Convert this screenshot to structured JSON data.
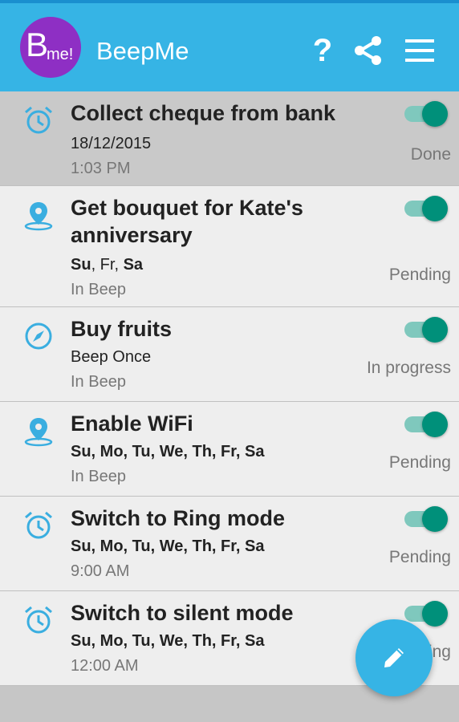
{
  "app": {
    "logo_big": "B",
    "logo_small": "me!",
    "title": "BeepMe",
    "help_glyph": "?",
    "accent_color": "#36b4e5",
    "toggle_color": "#00907a"
  },
  "items": [
    {
      "title": "Collect cheque from bank",
      "line1": "18/12/2015",
      "line2": "1:03 PM",
      "status": "Done",
      "icon": "alarm-icon",
      "enabled": true
    },
    {
      "title": "Get bouquet for Kate's anniversary",
      "line1_html": "<b>Su</b>, Fr, <b>Sa</b>",
      "line2": "In Beep",
      "status": "Pending",
      "icon": "location-pin-icon",
      "enabled": true
    },
    {
      "title": "Buy fruits",
      "line1": "Beep Once",
      "line2": "In Beep",
      "status": "In progress",
      "icon": "compass-icon",
      "enabled": true
    },
    {
      "title": "Enable WiFi",
      "line1": "Su, Mo, Tu, We, Th, Fr, Sa",
      "line2": "In Beep",
      "status": "Pending",
      "icon": "location-pin-icon",
      "enabled": true
    },
    {
      "title": "Switch to Ring mode",
      "line1": "Su, Mo, Tu, We, Th, Fr, Sa",
      "line2": "9:00 AM",
      "status": "Pending",
      "icon": "alarm-icon",
      "enabled": true
    },
    {
      "title": "Switch to silent mode",
      "line1": "Su, Mo, Tu, We, Th, Fr, Sa",
      "line2": "12:00 AM",
      "status": "Pending",
      "icon": "alarm-icon",
      "enabled": true
    }
  ]
}
